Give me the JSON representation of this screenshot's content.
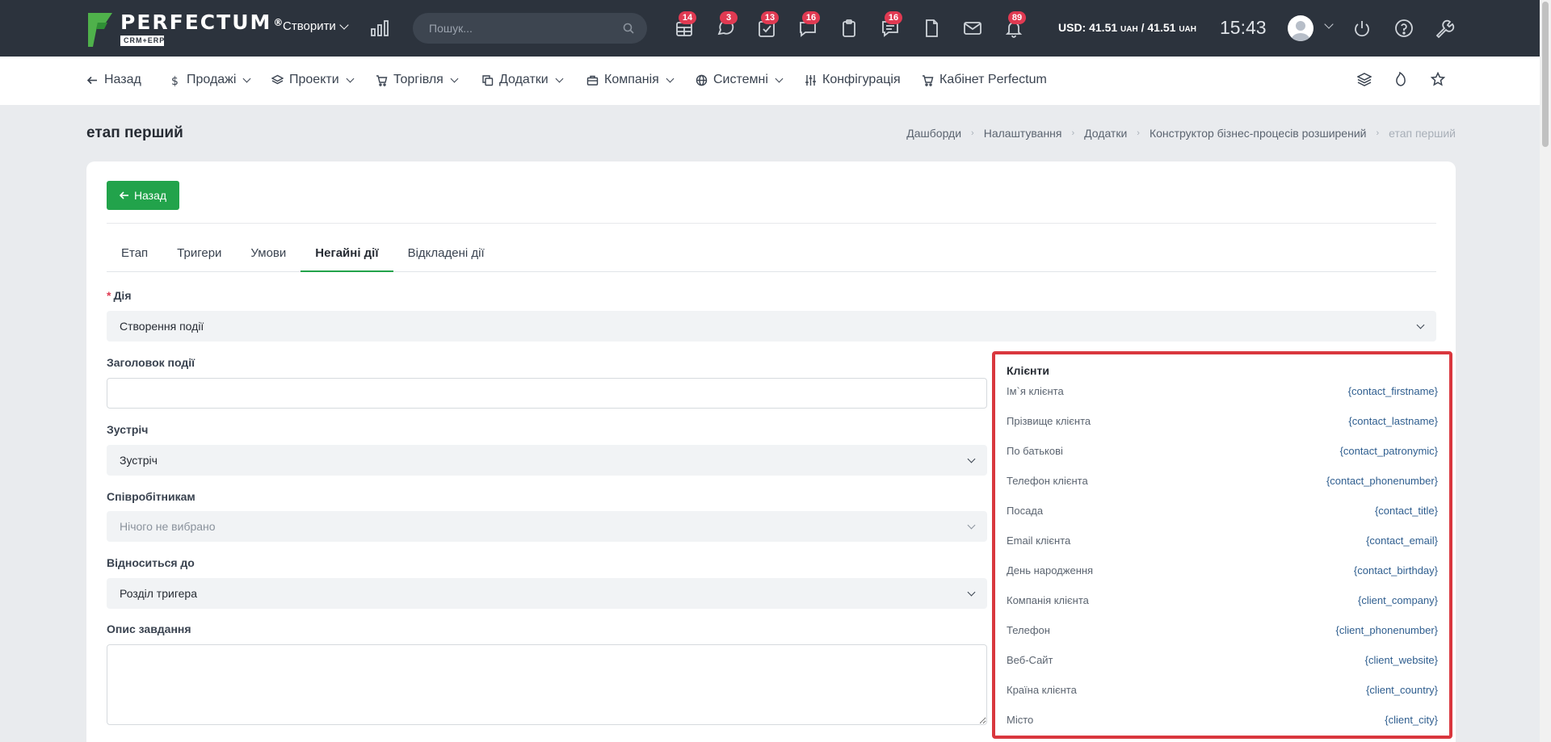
{
  "app": {
    "logo_text": "PERFECTUM",
    "logo_reg": "®",
    "logo_sub": "CRM+ERP"
  },
  "topbar": {
    "create_label": "Створити",
    "search_placeholder": "Пошук...",
    "badges": [
      "14",
      "3",
      "13",
      "16",
      "16",
      "89"
    ],
    "currency_text": "USD: 41.51",
    "currency_unit": "UAH",
    "currency_sep": " / 41.51 ",
    "currency_unit2": "UAH",
    "time": "15:43"
  },
  "nav": {
    "items": [
      "Назад",
      "Продажі",
      "Проекти",
      "Торгівля",
      "Додатки",
      "Компанія",
      "Системні",
      "Конфігурація",
      "Кабінет Perfectum"
    ]
  },
  "page": {
    "title": "етап перший",
    "breadcrumb": [
      "Дашборди",
      "Налаштування",
      "Додатки",
      "Конструктор бізнес-процесів розширений",
      "етап перший"
    ]
  },
  "form": {
    "back_label": "Назад",
    "tabs": [
      "Етап",
      "Тригери",
      "Умови",
      "Негайні дії",
      "Відкладені дії"
    ],
    "action_label": "Дія",
    "action_value": "Створення події",
    "event_title_label": "Заголовок події",
    "meeting_label": "Зустріч",
    "meeting_value": "Зустріч",
    "staff_label": "Співробітникам",
    "staff_placeholder": "Нічого не вибрано",
    "relates_label": "Відноситься до",
    "relates_value": "Розділ тригера",
    "description_label": "Опис завдання"
  },
  "variables": {
    "title": "Клієнти",
    "rows": [
      {
        "label": "Ім`я клієнта",
        "token": "{contact_firstname}"
      },
      {
        "label": "Прізвище клієнта",
        "token": "{contact_lastname}"
      },
      {
        "label": "По батькові",
        "token": "{contact_patronymic}"
      },
      {
        "label": "Телефон клієнта",
        "token": "{contact_phonenumber}"
      },
      {
        "label": "Посада",
        "token": "{contact_title}"
      },
      {
        "label": "Email клієнта",
        "token": "{contact_email}"
      },
      {
        "label": "День народження",
        "token": "{contact_birthday}"
      },
      {
        "label": "Компанія клієнта",
        "token": "{client_company}"
      },
      {
        "label": "Телефон",
        "token": "{client_phonenumber}"
      },
      {
        "label": "Веб-Сайт",
        "token": "{client_website}"
      },
      {
        "label": "Країна клієнта",
        "token": "{client_country}"
      },
      {
        "label": "Місто",
        "token": "{client_city}"
      }
    ]
  },
  "colors": {
    "topbar": "#2c333d",
    "accent_green": "#22a34b",
    "badge_red": "#e03a52",
    "highlight_red": "#d9373e",
    "token_blue": "#2f5e8f"
  }
}
